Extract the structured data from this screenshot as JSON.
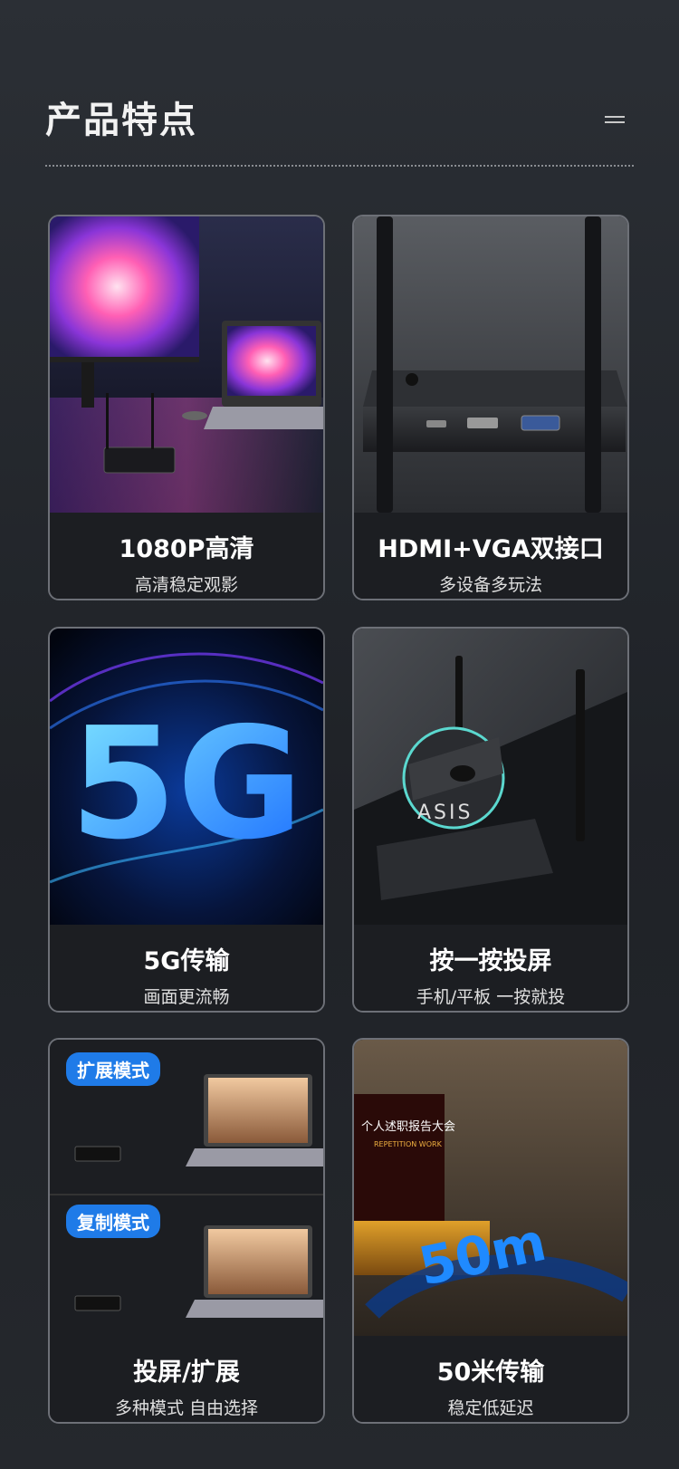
{
  "header": {
    "title": "产品特点"
  },
  "features": [
    {
      "title": "1080P高清",
      "subtitle": "高清稳定观影"
    },
    {
      "title": "HDMI+VGA双接口",
      "subtitle": "多设备多玩法"
    },
    {
      "title": "5G传输",
      "subtitle": "画面更流畅",
      "image_text": "5G"
    },
    {
      "title": "按一按投屏",
      "subtitle": "手机/平板 一按就投",
      "image_text": "ASIS"
    },
    {
      "title": "投屏/扩展",
      "subtitle": "多种模式 自由选择",
      "badges": [
        "扩展模式",
        "复制模式"
      ]
    },
    {
      "title": "50米传输",
      "subtitle": "稳定低延迟",
      "screen_text": "个人述职报告大会",
      "screen_sub": "REPETITION WORK",
      "image_text": "50m"
    }
  ],
  "colors": {
    "accent": "#1f7be8",
    "background": "#24272c",
    "card_border": "#6d7077"
  }
}
